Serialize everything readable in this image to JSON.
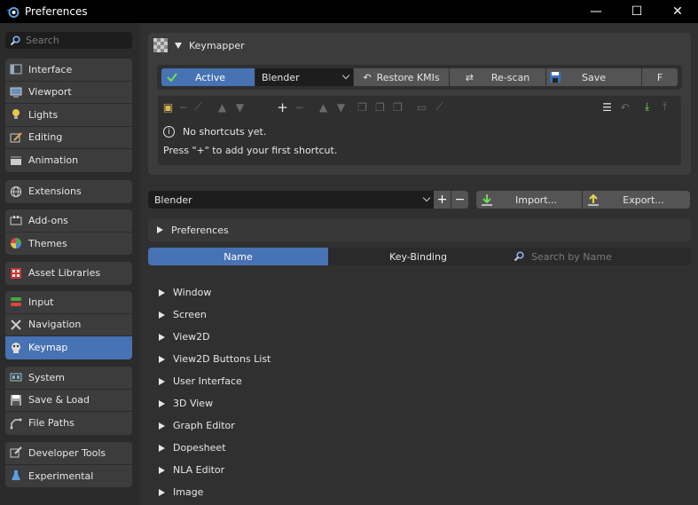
{
  "window": {
    "title": "Preferences",
    "controls": {
      "minimize": "—",
      "maximize": "☐",
      "close": "✕"
    }
  },
  "sidebar": {
    "search_placeholder": "Search",
    "groups": [
      [
        "Interface",
        "Viewport",
        "Lights",
        "Editing",
        "Animation"
      ],
      [
        "Extensions"
      ],
      [
        "Add-ons",
        "Themes"
      ],
      [
        "Asset Libraries"
      ],
      [
        "Input",
        "Navigation",
        "Keymap"
      ],
      [
        "System",
        "Save & Load",
        "File Paths"
      ],
      [
        "Developer Tools",
        "Experimental"
      ]
    ],
    "active_item": "Keymap"
  },
  "keymapper": {
    "title": "Keymapper",
    "active_label": "Active",
    "preset_select": "Blender",
    "restore_label": "Restore KMIs",
    "rescan_label": "Re-scan",
    "save_label": "Save",
    "f_label": "F",
    "add_glyph": "+",
    "remove_glyph": "−",
    "empty_title": "No shortcuts yet.",
    "empty_hint": "Press \"+\" to add your first shortcut."
  },
  "keymap_preset": {
    "select_value": "Blender",
    "add_glyph": "+",
    "remove_glyph": "−",
    "import_label": "Import...",
    "export_label": "Export..."
  },
  "preferences_section": {
    "label": "Preferences"
  },
  "filter_tabs": {
    "name_label": "Name",
    "keybinding_label": "Key-Binding",
    "search_placeholder": "Search by Name"
  },
  "keymap_items": [
    "Window",
    "Screen",
    "View2D",
    "View2D Buttons List",
    "User Interface",
    "3D View",
    "Graph Editor",
    "Dopesheet",
    "NLA Editor",
    "Image"
  ],
  "colors": {
    "accent": "#4772b3",
    "panel": "#3c3c3c",
    "background": "#303030"
  }
}
